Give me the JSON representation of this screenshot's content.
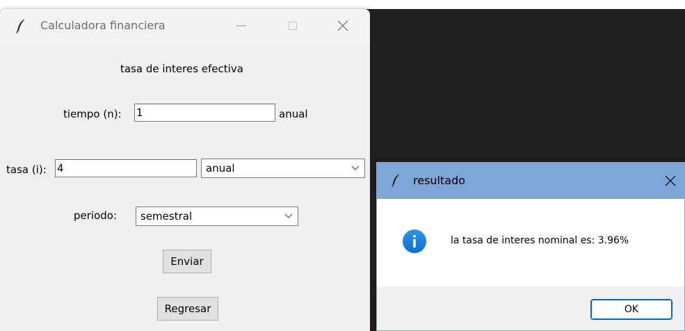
{
  "main_window": {
    "title": "Calculadora financiera",
    "icon": "feather-icon",
    "heading": "tasa de interes efectiva",
    "tiempo": {
      "label": "tiempo (n):",
      "value": "1",
      "unit": "anual"
    },
    "tasa": {
      "label": "tasa (i):",
      "value": "4",
      "period_selected": "anual"
    },
    "periodo": {
      "label": "periodo:",
      "selected": "semestral"
    },
    "buttons": {
      "enviar": "Enviar",
      "regresar": "Regresar"
    }
  },
  "dialog": {
    "title": "resultado",
    "icon": "feather-icon",
    "message_icon": "info-icon",
    "message": "la tasa de interes nominal es: 3.96%",
    "ok_label": "OK"
  },
  "colors": {
    "dialog_titlebar": "#7ea6d8",
    "ok_border": "#0067c0",
    "info_icon": "#1a7fd8",
    "desktop_dark": "#202020"
  }
}
